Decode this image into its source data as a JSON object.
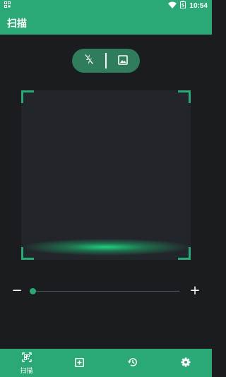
{
  "status_bar": {
    "time": "10:54",
    "battery_level": "5",
    "icons": [
      "notification-icon",
      "wifi-icon",
      "battery-icon"
    ]
  },
  "app_bar": {
    "title": "扫描"
  },
  "toolbar": {
    "icons": [
      "flash-off-icon",
      "gallery-icon"
    ]
  },
  "zoom": {
    "minus": "−",
    "plus": "+",
    "level": 0.0
  },
  "bottom_nav": {
    "items": [
      {
        "label": "扫描",
        "icon": "qr-scan-icon",
        "active": true
      },
      {
        "label": "",
        "icon": "add-box-icon",
        "active": false
      },
      {
        "label": "",
        "icon": "history-icon",
        "active": false
      },
      {
        "label": "",
        "icon": "settings-icon",
        "active": false
      }
    ]
  },
  "colors": {
    "primary": "#2aa876",
    "background": "#1a1c1f",
    "pill": "#2f7d5c"
  }
}
